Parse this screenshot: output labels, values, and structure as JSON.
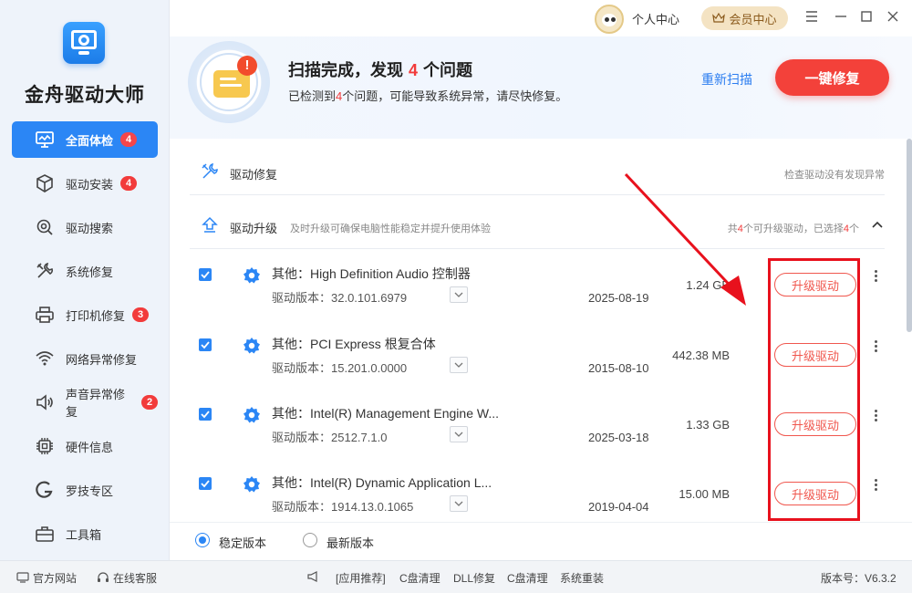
{
  "app": {
    "name": "金舟驱动大师"
  },
  "sidebar": {
    "items": [
      {
        "label": "全面体检",
        "badge": "4",
        "icon": "monitor-icon",
        "active": true
      },
      {
        "label": "驱动安装",
        "badge": "4",
        "icon": "box-icon"
      },
      {
        "label": "驱动搜索",
        "badge": "",
        "icon": "gear-search-icon"
      },
      {
        "label": "系统修复",
        "badge": "",
        "icon": "tools-icon"
      },
      {
        "label": "打印机修复",
        "badge": "3",
        "icon": "printer-icon"
      },
      {
        "label": "网络异常修复",
        "badge": "",
        "icon": "wifi-icon"
      },
      {
        "label": "声音异常修复",
        "badge": "2",
        "icon": "speaker-icon"
      },
      {
        "label": "硬件信息",
        "badge": "",
        "icon": "chip-icon"
      },
      {
        "label": "罗技专区",
        "badge": "",
        "icon": "logitech-icon"
      },
      {
        "label": "工具箱",
        "badge": "",
        "icon": "toolbox-icon"
      }
    ]
  },
  "topbar": {
    "user_center": "个人中心",
    "vip": "会员中心"
  },
  "header": {
    "title_prefix": "扫描完成，发现",
    "title_count": "4",
    "title_suffix": "个问题",
    "sub_prefix": "已检测到",
    "sub_count": "4",
    "sub_suffix": "个问题，可能导致系统异常，请尽快修复。",
    "rescan": "重新扫描",
    "fix_all": "一键修复"
  },
  "sections": {
    "repair": {
      "title": "驱动修复",
      "right": "检查驱动没有发现异常"
    },
    "upgrade": {
      "title": "驱动升级",
      "desc": "及时升级可确保电脑性能稳定并提升使用体验",
      "right_prefix": "共",
      "right_total": "4",
      "right_mid": "个可升级驱动，已选择",
      "right_selected": "4",
      "right_suffix": "个"
    }
  },
  "drivers": [
    {
      "name": "其他：High Definition Audio 控制器",
      "version": "驱动版本：32.0.101.6979",
      "date": "2025-08-19",
      "size": "1.24 GB",
      "action": "升级驱动",
      "checked": true
    },
    {
      "name": "其他：PCI Express 根复合体",
      "version": "驱动版本：15.201.0.0000",
      "date": "2015-08-10",
      "size": "442.38 MB",
      "action": "升级驱动",
      "checked": true
    },
    {
      "name": "其他：Intel(R) Management Engine W...",
      "version": "驱动版本：2512.7.1.0",
      "date": "2025-03-18",
      "size": "1.33 GB",
      "action": "升级驱动",
      "checked": true
    },
    {
      "name": "其他：Intel(R) Dynamic Application L...",
      "version": "驱动版本：1914.13.0.1065",
      "date": "2019-04-04",
      "size": "15.00 MB",
      "action": "升级驱动",
      "checked": true
    }
  ],
  "version_options": {
    "stable": "稳定版本",
    "latest": "最新版本",
    "selected": "stable"
  },
  "footer": {
    "website": "官方网站",
    "service": "在线客服",
    "recommend": "[应用推荐]",
    "links": [
      "C盘清理",
      "DLL修复",
      "C盘清理",
      "系统重装"
    ],
    "version": "版本号：V6.3.2"
  },
  "colors": {
    "accent": "#2b86f5",
    "danger": "#f3413a",
    "annotation": "#e8111d"
  }
}
